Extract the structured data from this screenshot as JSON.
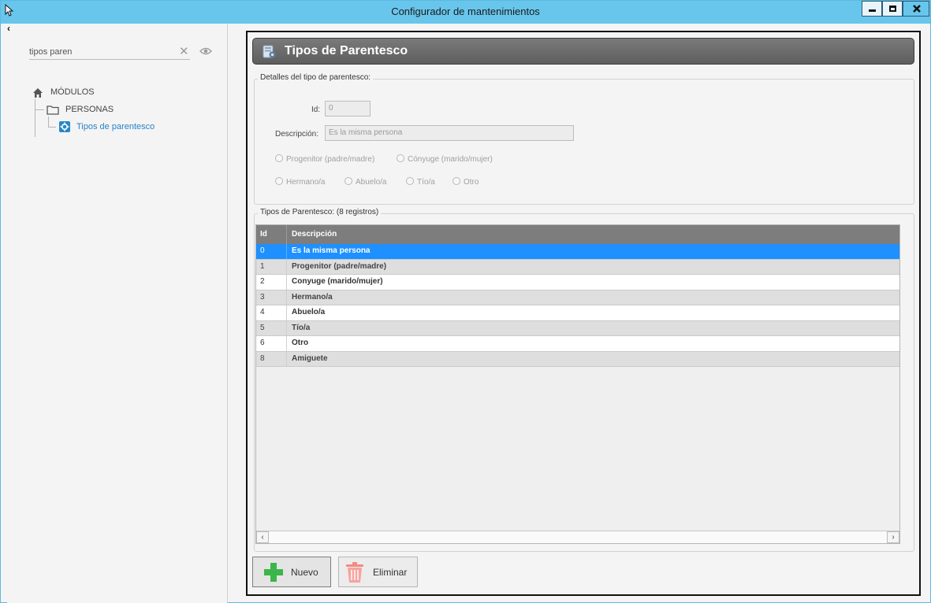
{
  "window": {
    "title": "Configurador de mantenimientos"
  },
  "sidebar": {
    "collapse_glyph": "‹",
    "search": {
      "value": "tipos paren",
      "placeholder": ""
    },
    "tree": {
      "root": "MÓDULOS",
      "group": "PERSONAS",
      "item": "Tipos de parentesco"
    }
  },
  "content": {
    "header_title": "Tipos de Parentesco",
    "details": {
      "legend": "Detalles del tipo de parentesco:",
      "id_label": "Id:",
      "id_value": "0",
      "desc_label": "Descripción:",
      "desc_value": "Es la misma persona",
      "radios": [
        "Progenitor (padre/madre)",
        "Cónyuge (marido/mujer)",
        "Hermano/a",
        "Abuelo/a",
        "Tío/a",
        "Otro"
      ]
    },
    "list": {
      "legend": "Tipos de Parentesco:  (8 registros)",
      "columns": [
        "Id",
        "Descripción"
      ],
      "rows": [
        {
          "id": "0",
          "desc": "Es la misma persona"
        },
        {
          "id": "1",
          "desc": "Progenitor (padre/madre)"
        },
        {
          "id": "2",
          "desc": "Conyuge (marido/mujer)"
        },
        {
          "id": "3",
          "desc": "Hermano/a"
        },
        {
          "id": "4",
          "desc": "Abuelo/a"
        },
        {
          "id": "5",
          "desc": "Tío/a"
        },
        {
          "id": "6",
          "desc": "Otro"
        },
        {
          "id": "8",
          "desc": "Amiguete"
        }
      ],
      "selected_index": 0
    },
    "buttons": {
      "new_label": "Nuevo",
      "delete_label": "Eliminar"
    }
  },
  "colors": {
    "titlebar": "#68c6ec",
    "selection": "#1e90ff",
    "header_bar": "#6b6b6b",
    "add_icon": "#3cb54a",
    "delete_icon": "#f28b82"
  }
}
